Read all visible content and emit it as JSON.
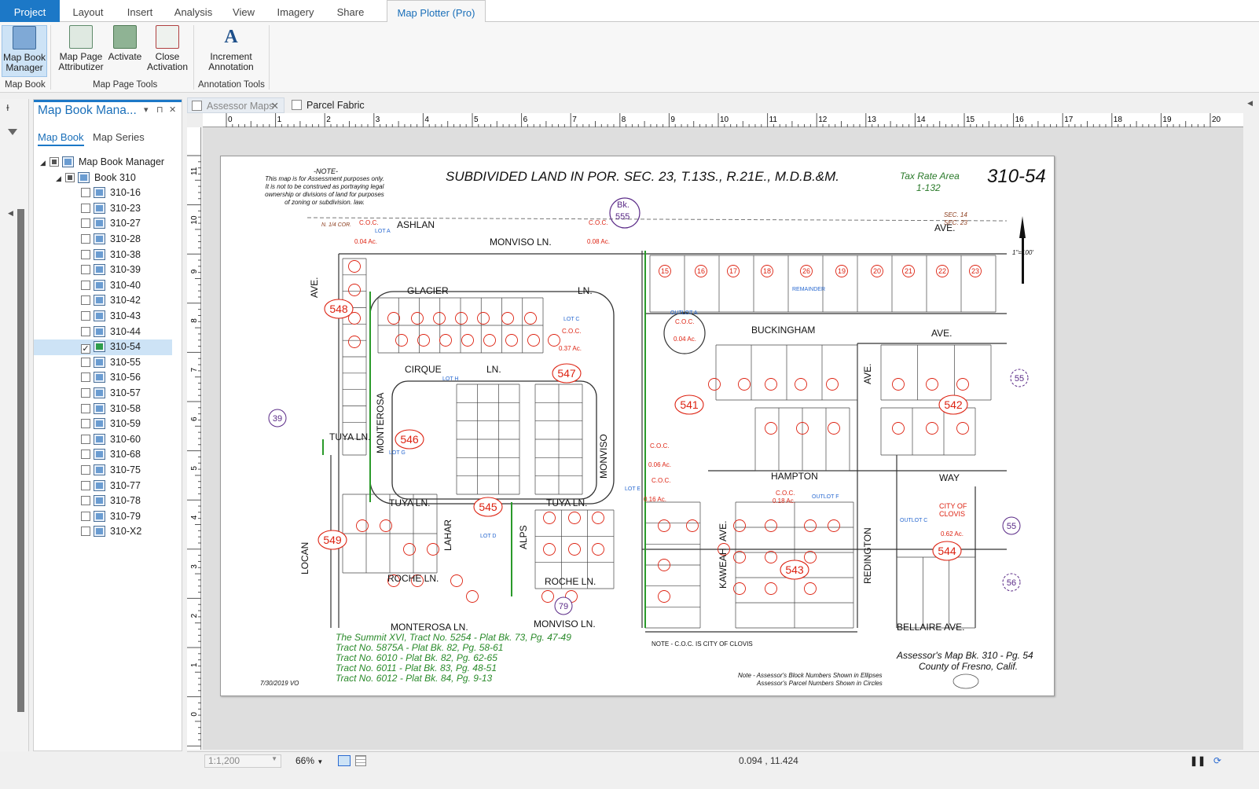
{
  "ribbon_tabs": [
    "Project",
    "Layout",
    "Insert",
    "Analysis",
    "View",
    "Imagery",
    "Share",
    "Map Plotter (Pro)"
  ],
  "ribbon": {
    "map_book_manager": "Map Book Manager",
    "map_page_attributizer": "Map Page Attributizer",
    "activate": "Activate",
    "close_activation": "Close Activation",
    "increment_annotation": "Increment Annotation",
    "groups": [
      "Map Book",
      "Map Page Tools",
      "Annotation Tools"
    ]
  },
  "pane": {
    "title": "Map Book Mana...",
    "subtabs": [
      "Map Book",
      "Map Series"
    ],
    "root": "Map Book Manager",
    "book": "Book 310",
    "pages": [
      "310-16",
      "310-23",
      "310-27",
      "310-28",
      "310-38",
      "310-39",
      "310-40",
      "310-42",
      "310-43",
      "310-44",
      "310-54",
      "310-55",
      "310-56",
      "310-57",
      "310-58",
      "310-59",
      "310-60",
      "310-68",
      "310-75",
      "310-77",
      "310-78",
      "310-79",
      "310-X2"
    ],
    "selected": "310-54"
  },
  "view_tabs": [
    "Assessor Maps",
    "Parcel Fabric"
  ],
  "ruler_top": [
    "0",
    "1",
    "2",
    "3",
    "4",
    "5",
    "6",
    "7",
    "8",
    "9",
    "10",
    "11",
    "12",
    "13",
    "14",
    "15",
    "16",
    "17",
    "18",
    "19",
    "20"
  ],
  "ruler_left": [
    "11",
    "10",
    "9",
    "8",
    "7",
    "6",
    "5",
    "4",
    "3",
    "2",
    "1",
    "0"
  ],
  "map": {
    "note_title": "-NOTE-",
    "note_lines": [
      "This map is for Assessment purposes only.",
      "It is not to be construed as portraying legal",
      "ownership or divisions of land for purposes",
      "of zoning or subdivision. law."
    ],
    "title": "SUBDIVIDED LAND IN POR. SEC. 23, T.13S., R.21E., M.D.B.&M.",
    "tax_rate_area": "Tax Rate Area",
    "tax_rate_value": "1-132",
    "page_number": "310-54",
    "bk_label": "Bk.",
    "bk_value": "555",
    "scale": "1\"=100'",
    "streets": {
      "ashlan": "ASHLAN",
      "ave_top": "AVE.",
      "monviso_ln_top": "MONVISO LN.",
      "glacier": "GLACIER",
      "ln_glacier": "LN.",
      "buckingham": "BUCKINGHAM",
      "ave_buck": "AVE.",
      "cirque": "CIRQUE",
      "ln_cirque": "LN.",
      "hampton": "HAMPTON",
      "way": "WAY",
      "tuya_ln_left": "TUYA LN.",
      "tuya_ln_mid": "TUYA LN.",
      "tuya_ln_right": "TUYA LN.",
      "roche_ln_left": "ROCHE LN.",
      "roche_ln_right": "ROCHE LN.",
      "monterosa_ln": "MONTEROSA LN.",
      "monviso_ln_bottom": "MONVISO LN.",
      "bellaire": "BELLAIRE AVE.",
      "locan": "LOCAN",
      "ave_locan": "AVE.",
      "monterosa_v": "MONTEROSA",
      "monviso_v": "MONVISO",
      "lahar": "LAHAR",
      "alps": "ALPS",
      "kaweah": "KAWEAH",
      "ave_kaweah": "AVE.",
      "redington": "REDINGTON",
      "ave_redington": "AVE.",
      "ave_right": "AVE."
    },
    "sec_labels": [
      "SEC. 14",
      "SEC. 23"
    ],
    "quarter_cor": "N. 1/4 COR.",
    "coc_labels": [
      "C.O.C.",
      "C.O.C.",
      "C.O.C.",
      "C.O.C.",
      "C.O.C.",
      "C.O.C.",
      "C.O.C."
    ],
    "acreages": [
      "0.04 Ac.",
      "0.08 Ac.",
      "0.37 Ac.",
      "0.04 Ac.",
      "0.06 Ac.",
      "0.16 Ac.",
      "0.18 Ac.",
      "0.62 Ac."
    ],
    "lot_labels": [
      "LOT A",
      "OUTLOT A",
      "LOT C",
      "LOT H",
      "OUTLOT C",
      "OUTLOT F",
      "LOT D",
      "LOT G",
      "LOT E",
      "REMAINDER",
      "CITY OF",
      "CLOVIS"
    ],
    "block_numbers": [
      "548",
      "547",
      "541",
      "542",
      "546",
      "545",
      "549",
      "543",
      "544"
    ],
    "ext_block_numbers": [
      "39",
      "55",
      "55",
      "56",
      "79"
    ],
    "parcel_numbers_top": [
      "15",
      "16",
      "17",
      "18",
      "26",
      "19",
      "20",
      "21",
      "22",
      "23"
    ],
    "tracts": [
      "The Summit XVI, Tract No. 5254 - Plat Bk. 73, Pg. 47-49",
      "Tract No. 5875A - Plat Bk. 82, Pg. 58-61",
      "Tract No. 6010 - Plat Bk. 82, Pg. 62-65",
      "Tract No. 6011 - Plat Bk. 83, Pg. 48-51",
      "Tract No. 6012 - Plat Bk. 84, Pg. 9-13"
    ],
    "note_coc": "NOTE - C.O.C. IS CITY OF CLOVIS",
    "assessor_map": "Assessor's Map Bk. 310 - Pg. 54",
    "county": "County of Fresno, Calif.",
    "note_bottom_1": "Note - Assessor's Block Numbers Shown in Ellipses",
    "note_bottom_2": "Assessor's Parcel Numbers Shown in Circles",
    "date": "7/30/2019  VO"
  },
  "status": {
    "scale": "1:1,200",
    "zoom": "66%",
    "coords": "0.094 , 11.424"
  }
}
